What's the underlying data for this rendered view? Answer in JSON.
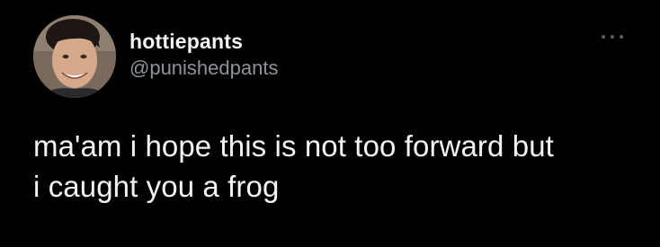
{
  "tweet": {
    "author": {
      "display_name": "hottiepants",
      "handle": "@punishedpants",
      "avatar_icon": "profile-photo"
    },
    "more_icon": "ellipsis-icon",
    "text_lines": [
      "ma'am i hope this is not too forward but",
      "i caught you a frog"
    ]
  },
  "colors": {
    "background": "#000000",
    "display_name": "#f5f5f5",
    "handle": "#8b949c",
    "body_text": "#f3f3f3"
  }
}
